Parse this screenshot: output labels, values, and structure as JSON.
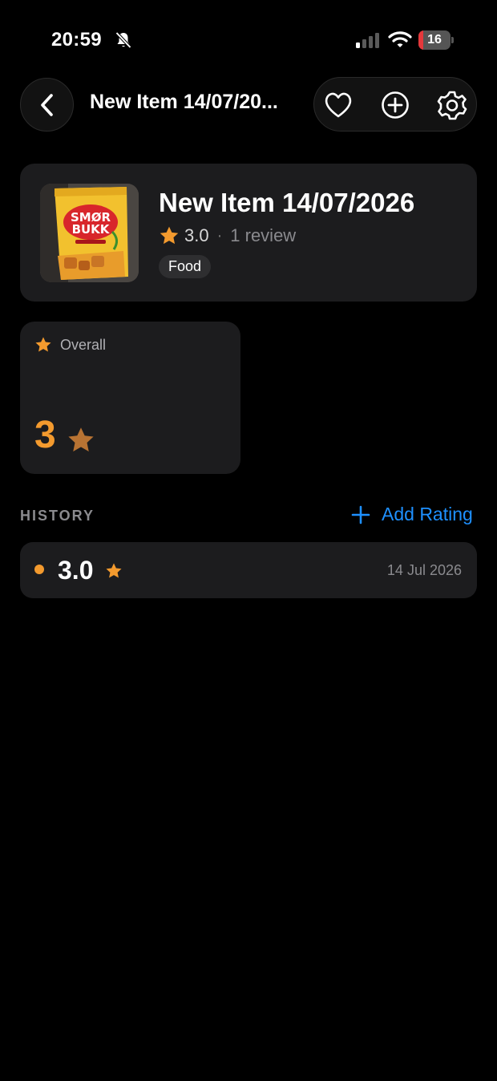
{
  "status_bar": {
    "time": "20:59",
    "battery_level": "16",
    "battery_fraction": 0.16,
    "icons": [
      "bell-slash-icon",
      "cellular-signal-icon",
      "wifi-icon",
      "battery-icon"
    ],
    "battery_color": "#e5383b"
  },
  "nav": {
    "title": "New Item 14/07/20...",
    "back_icon": "chevron-left-icon",
    "actions": [
      "heart-icon",
      "plus-circle-icon",
      "gear-icon"
    ]
  },
  "item": {
    "title": "New Item 14/07/2026",
    "rating": "3.0",
    "separator": "·",
    "reviews": "1 review",
    "tag": "Food",
    "thumbnail_text": "SMØR BUKK"
  },
  "overall": {
    "label": "Overall",
    "value": "3",
    "accent": "#f39a2e"
  },
  "history": {
    "section_label": "HISTORY",
    "add_label": "Add Rating",
    "link_color": "#1e90ff",
    "entries": [
      {
        "value": "3.0",
        "date": "14 Jul 2026"
      }
    ]
  }
}
